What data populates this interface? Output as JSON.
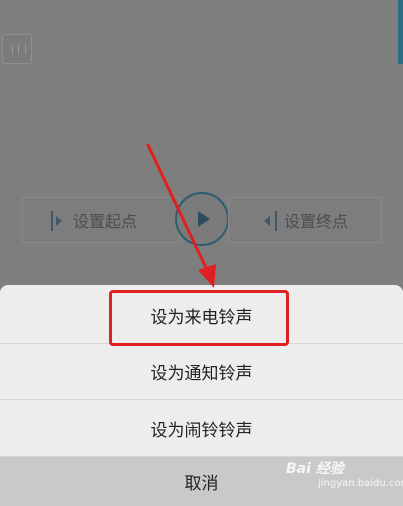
{
  "background": {
    "set_start_label": "设置起点",
    "set_end_label": "设置终点"
  },
  "sheet": {
    "items": [
      {
        "label": "设为来电铃声"
      },
      {
        "label": "设为通知铃声"
      },
      {
        "label": "设为闹铃铃声"
      }
    ],
    "cancel_label": "取消"
  },
  "watermark": {
    "brand": "Bai 经验",
    "sub": "jingyan.baidu.com"
  },
  "colors": {
    "overlay": "#7e7e7e",
    "sheet_bg": "#ededed",
    "cancel_bg": "#c9c9c9",
    "highlight": "#e02020",
    "accent": "#2a6f86"
  },
  "icons": [
    "pause-icon",
    "play-icon",
    "set-start-icon",
    "set-end-icon",
    "red-arrow-annotation"
  ]
}
